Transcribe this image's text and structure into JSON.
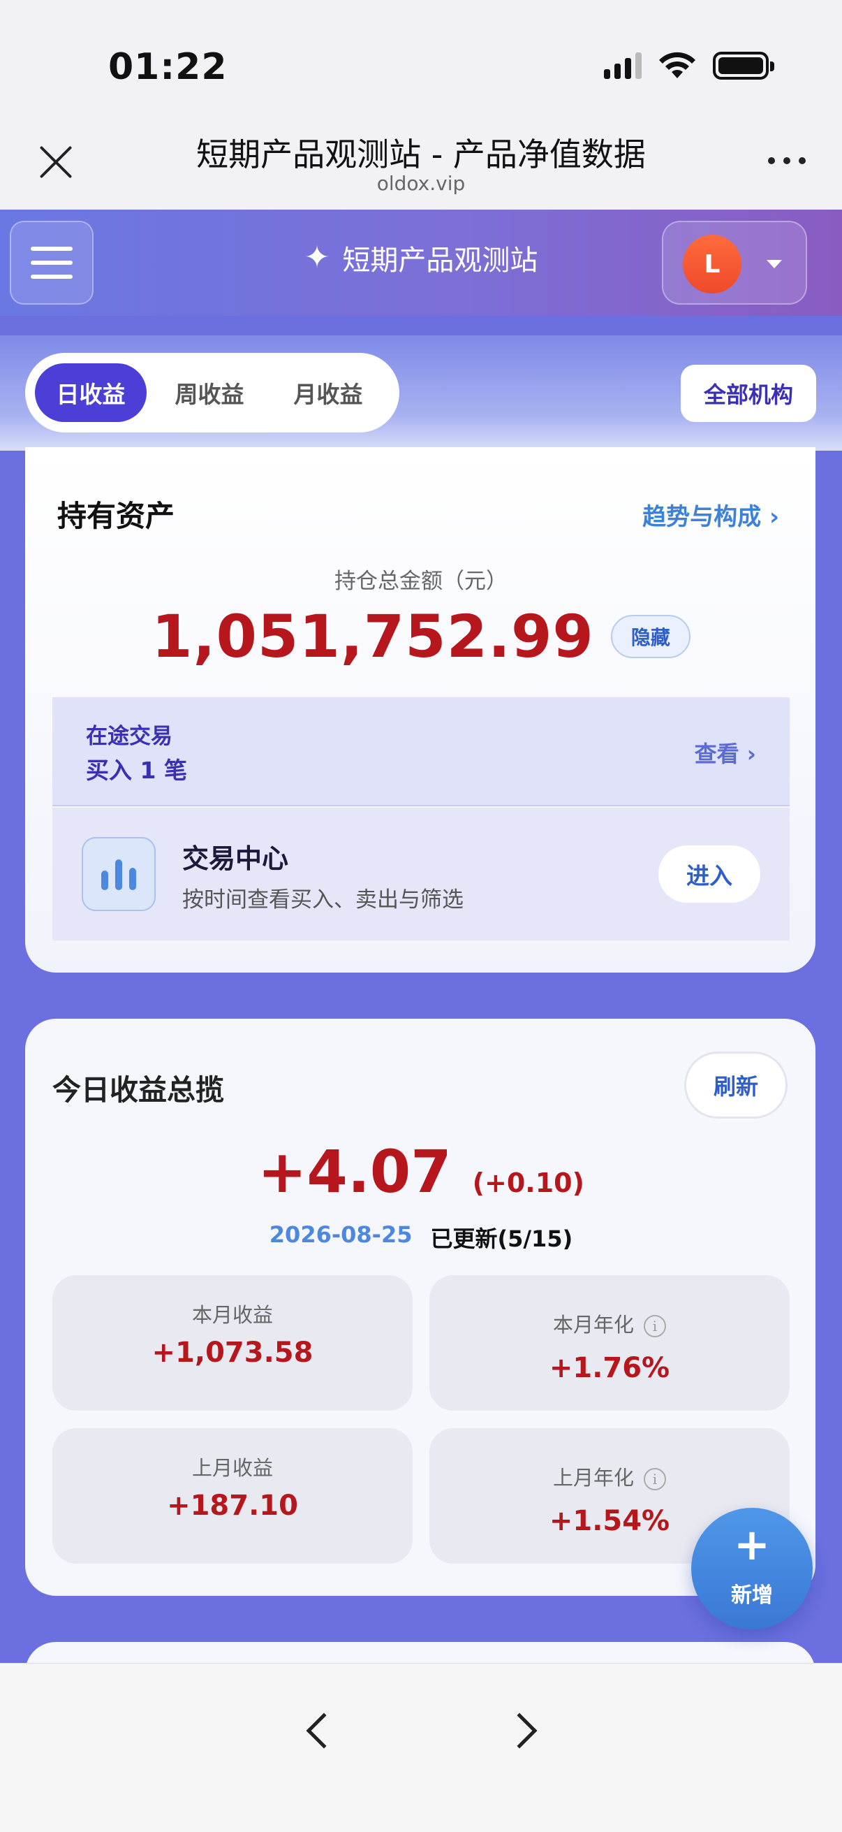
{
  "status_bar": {
    "time": "01:22"
  },
  "browser": {
    "title": "短期产品观测站 - 产品净值数据",
    "url": "oldox.vip"
  },
  "app": {
    "title": "短期产品观测站",
    "avatar_letter": "L"
  },
  "tabs": [
    {
      "label": "日收益",
      "active": true
    },
    {
      "label": "周收益",
      "active": false
    },
    {
      "label": "月收益",
      "active": false
    }
  ],
  "org_filter": "全部机构",
  "assets": {
    "title": "持有资产",
    "trend_link": "趋势与构成 ›",
    "total_label": "持仓总金额（元）",
    "total_value": "1,051,752.99",
    "hide_label": "隐藏",
    "in_transit": {
      "title": "在途交易",
      "detail": "买入 1 笔",
      "view_label": "查看 ›"
    },
    "trade_center": {
      "title": "交易中心",
      "subtitle": "按时间查看买入、卖出与筛选",
      "enter_label": "进入"
    }
  },
  "earnings": {
    "title": "今日收益总揽",
    "refresh_label": "刷新",
    "today_value": "+4.07",
    "today_delta": "(+0.10)",
    "date": "2026-08-25",
    "updated": "已更新(5/15)",
    "stats": [
      {
        "label": "本月收益",
        "value": "+1,073.58",
        "has_info": false
      },
      {
        "label": "本月年化",
        "value": "+1.76%",
        "has_info": true
      },
      {
        "label": "上月收益",
        "value": "+187.10",
        "has_info": false
      },
      {
        "label": "上月年化",
        "value": "+1.54%",
        "has_info": true
      }
    ]
  },
  "fab": {
    "plus": "+",
    "label": "新增"
  },
  "colors": {
    "accent": "#4b3fd8",
    "gain": "#b5171c",
    "link": "#3b82d8"
  }
}
